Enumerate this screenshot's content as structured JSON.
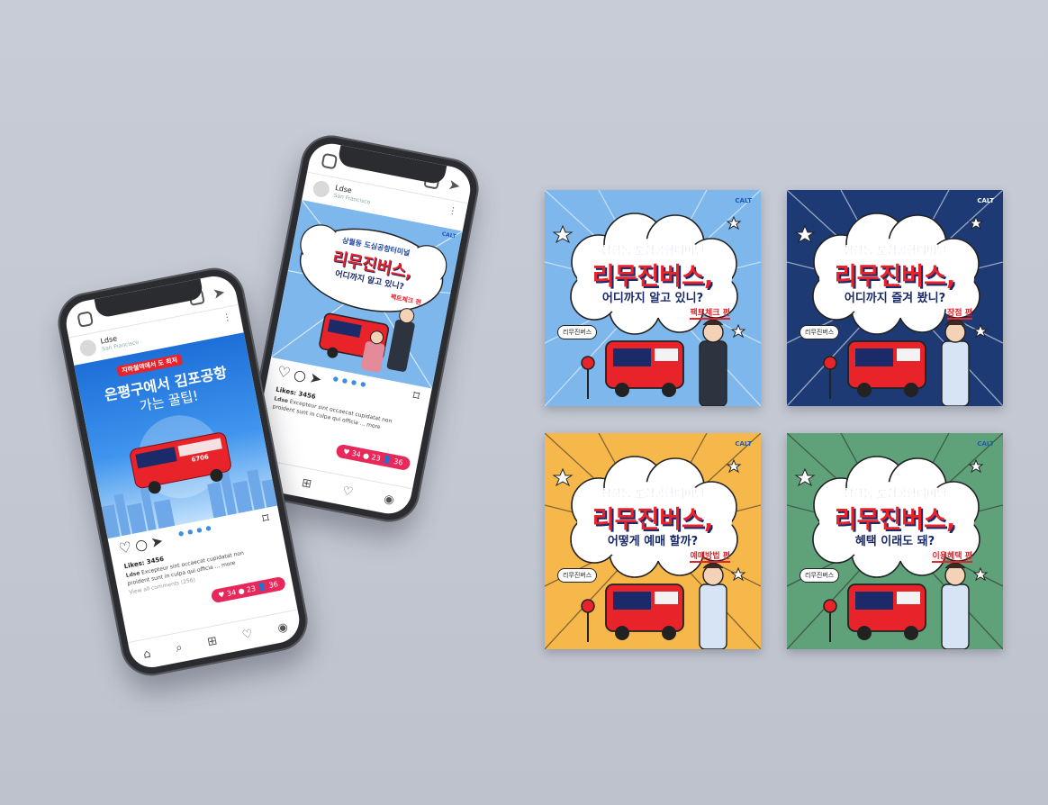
{
  "colors": {
    "background": "#c6cad4",
    "accent_red": "#e8232a",
    "navy": "#1b2b6a",
    "ig_badge": "#e8285b",
    "card_blue": "#7db7ec",
    "card_navy": "#1d3a74",
    "card_yellow": "#f6b84b",
    "card_green": "#5fa27a"
  },
  "phone_left": {
    "username": "Ldse",
    "location": "San Francisco",
    "post": {
      "kicker": "지하철역에서 도 최저",
      "headline": "은평구에서 김포공항",
      "subline": "가는 꿀팁!",
      "bus_number": "6706"
    },
    "likes": "Likes: 3456",
    "caption_user": "Ldse",
    "caption": "Excepteur sint occaecat cupidatat non proident sunt in culpa qui officia ... more",
    "view_comments": "View all comments (256)",
    "badge": {
      "likes": "34",
      "comments": "23",
      "followers": "36"
    },
    "icons": [
      "home-icon",
      "search-icon",
      "add-icon",
      "heart-icon",
      "profile-icon"
    ]
  },
  "phone_right": {
    "username": "Ldse",
    "location": "San Francisco",
    "post": {
      "line1": "상월동 도심공항터미널",
      "line2": "리무진버스,",
      "line3": "어디까지 알고 있니?",
      "tag": "팩트체크 편",
      "logo": "CALT"
    },
    "likes": "Likes: 3456",
    "caption_user": "Ldse",
    "caption": "Excepteur sint occaecat cupidatat non proident sunt in culpa qui officia ... more",
    "badge": {
      "likes": "34",
      "comments": "23",
      "followers": "36"
    }
  },
  "cards": [
    {
      "bg": "#7db7ec",
      "line1": "삼성동 도심공항터미널",
      "line2": "리무진버스,",
      "line3": "어디까지 알고 있니?",
      "tag": "팩트체크 편",
      "logo": "CALT",
      "sign": "리무진버스"
    },
    {
      "bg": "#1d3a74",
      "line1": "삼성동 도심공항터미널",
      "line2": "리무진버스,",
      "line3": "어디까지 즐겨 봤니?",
      "tag": "장점 편",
      "logo": "CALT",
      "sign": "리무진버스"
    },
    {
      "bg": "#f6b84b",
      "line1": "삼성동 도심공항터미널",
      "line2": "리무진버스,",
      "line3": "어떻게 예매 할까?",
      "tag": "예매방법 편",
      "logo": "CALT",
      "sign": "리무진버스"
    },
    {
      "bg": "#5fa27a",
      "line1": "삼성동 도심공항터미널",
      "line2": "리무진버스,",
      "line3": "혜택 이래도 돼?",
      "tag": "이용혜택 편",
      "logo": "CALT",
      "sign": "리무진버스"
    }
  ]
}
